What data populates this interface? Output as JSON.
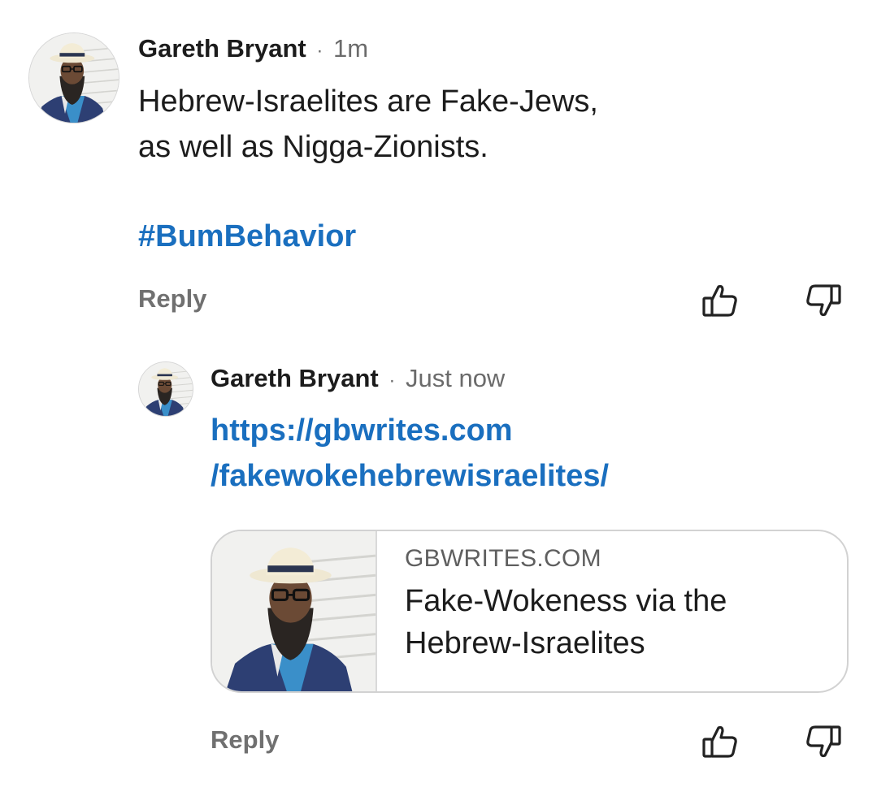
{
  "comment": {
    "author": "Gareth Bryant",
    "separator": "·",
    "time": "1m",
    "text_line1": "Hebrew-Israelites are Fake-Jews,",
    "text_line2": "as well as Nigga-Zionists.",
    "hashtag": "#BumBehavior",
    "reply_label": "Reply",
    "like_icon": "thumbs-up-icon",
    "dislike_icon": "thumbs-down-icon"
  },
  "reply_comment": {
    "author": "Gareth Bryant",
    "separator": "·",
    "time": "Just now",
    "link_line1": "https://gbwrites.com",
    "link_line2": "/fakewokehebrewisraelites/",
    "preview": {
      "domain": "GBWRITES.COM",
      "title_line1": "Fake-Wokeness via the",
      "title_line2": "Hebrew-Israelites"
    },
    "reply_label": "Reply",
    "like_icon": "thumbs-up-icon",
    "dislike_icon": "thumbs-down-icon"
  },
  "colors": {
    "link": "#1a6fbf",
    "muted": "#707070",
    "text": "#1c1c1c"
  }
}
